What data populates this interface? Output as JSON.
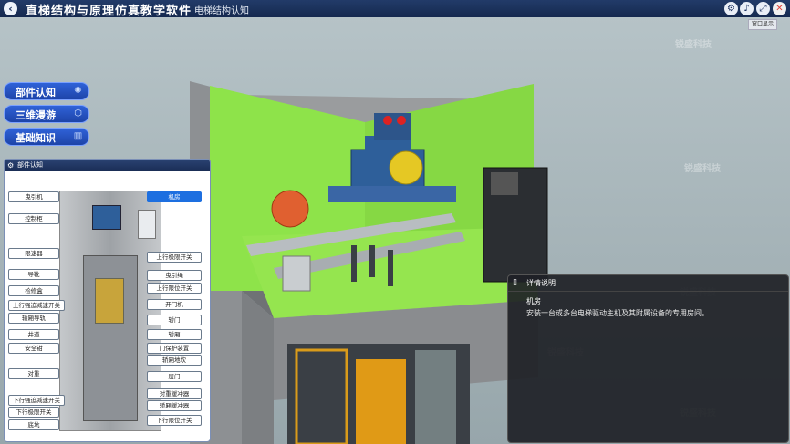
{
  "topbar": {
    "app_title": "直梯结构与原理仿真教学软件",
    "module_title": "电梯结构认知",
    "tooltip": "窗口显示",
    "icons": [
      "back-icon",
      "gear-icon",
      "speaker-icon",
      "fullscreen-icon",
      "close-icon"
    ]
  },
  "menu": [
    {
      "label": "部件认知",
      "icon": "spinner-icon"
    },
    {
      "label": "三维漫游",
      "icon": "cube-icon"
    },
    {
      "label": "基础知识",
      "icon": "book-icon"
    }
  ],
  "parts_panel": {
    "title": "部件认知",
    "left_labels": [
      "曳引机",
      "控制柜",
      "限速器",
      "导靴",
      "检修盒",
      "上行强迫减速开关",
      "轿厢导轨",
      "井道",
      "安全钳",
      "对重",
      "下行强迫减速开关",
      "下行极限开关",
      "底坑"
    ],
    "right_labels": [
      "机房",
      "上行极限开关",
      "曳引绳",
      "上行限位开关",
      "开门机",
      "轿门",
      "轿厢",
      "门保护装置",
      "轿厢地坎",
      "层门",
      "对重缓冲器",
      "轿厢缓冲器",
      "下行限位开关"
    ],
    "selected": "机房"
  },
  "detail_panel": {
    "title": "详情说明",
    "name": "机房",
    "description": "安装一台或多台电梯驱动主机及其附属设备的专用房间。"
  },
  "watermark": "锐盛科技",
  "colors": {
    "accent": "#1d6fe0",
    "green_wall": "#8ee34a",
    "machine_blue": "#2e5f9a"
  }
}
